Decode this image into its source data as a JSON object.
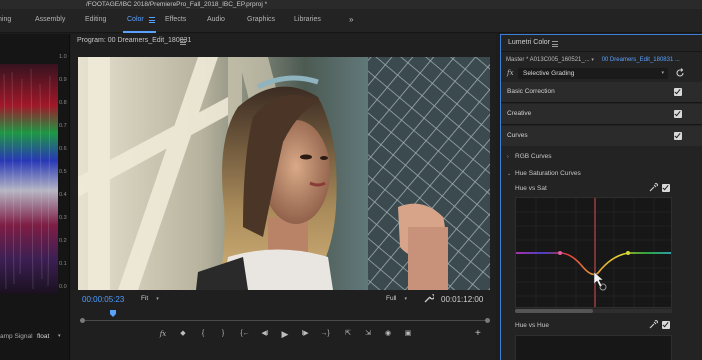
{
  "titlebar": {
    "path": "/FOOTAGE/IBC 2018/PremierePro_Fall_2018_IBC_EP.prproj *"
  },
  "workspaces": {
    "items": [
      "ning",
      "Assembly",
      "Editing",
      "Color",
      "Effects",
      "Audio",
      "Graphics",
      "Libraries"
    ],
    "active": "Color",
    "overflow": "»"
  },
  "scope": {
    "footer_label": "amp Signal",
    "footer_value": "float",
    "ticks": [
      "1.0",
      "0.9",
      "0.8",
      "0.7",
      "0.6",
      "0.5",
      "0.4",
      "0.3",
      "0.2",
      "0.1",
      "0.0"
    ]
  },
  "program": {
    "title": "Program: 00 Dreamers_Edit_180831",
    "timecode_current": "00:00:05:23",
    "timecode_duration": "00:01:12:00",
    "zoom_value": "Fit",
    "resolution_value": "Full",
    "progress_fraction": 0.08,
    "transport_icons": [
      "fx-icon",
      "marker-icon",
      "in-point-icon",
      "out-point-icon",
      "go-to-in-icon",
      "step-back-icon",
      "play-icon",
      "step-forward-icon",
      "go-to-out-icon",
      "insert-icon",
      "overwrite-icon",
      "camera-icon",
      "compare-icon"
    ],
    "transport_glyphs": [
      "fx",
      "◆",
      "{",
      "}",
      "{←",
      "◀I",
      "▶",
      "I▶",
      "→}",
      "⇱",
      "⇲",
      "◉",
      "▣"
    ]
  },
  "lumetri": {
    "title": "Lumetri Color",
    "master_clip": "Master * A013C005_160521_...",
    "sequence_clip": "00 Dreamers_Edit_180831 ...",
    "fx_label": "fx",
    "effect_select": "Selective Grading",
    "sections": [
      "Basic Correction",
      "Creative",
      "Curves"
    ],
    "subsections": [
      "RGB Curves",
      "Hue Saturation Curves"
    ],
    "curve1_title": "Hue vs Sat",
    "curve2_title": "Hue vs Hue"
  },
  "colors": {
    "accent": "#5aa2ff",
    "panel_focus_border": "#3c7fd9",
    "playhead_line": "#d9534f"
  }
}
